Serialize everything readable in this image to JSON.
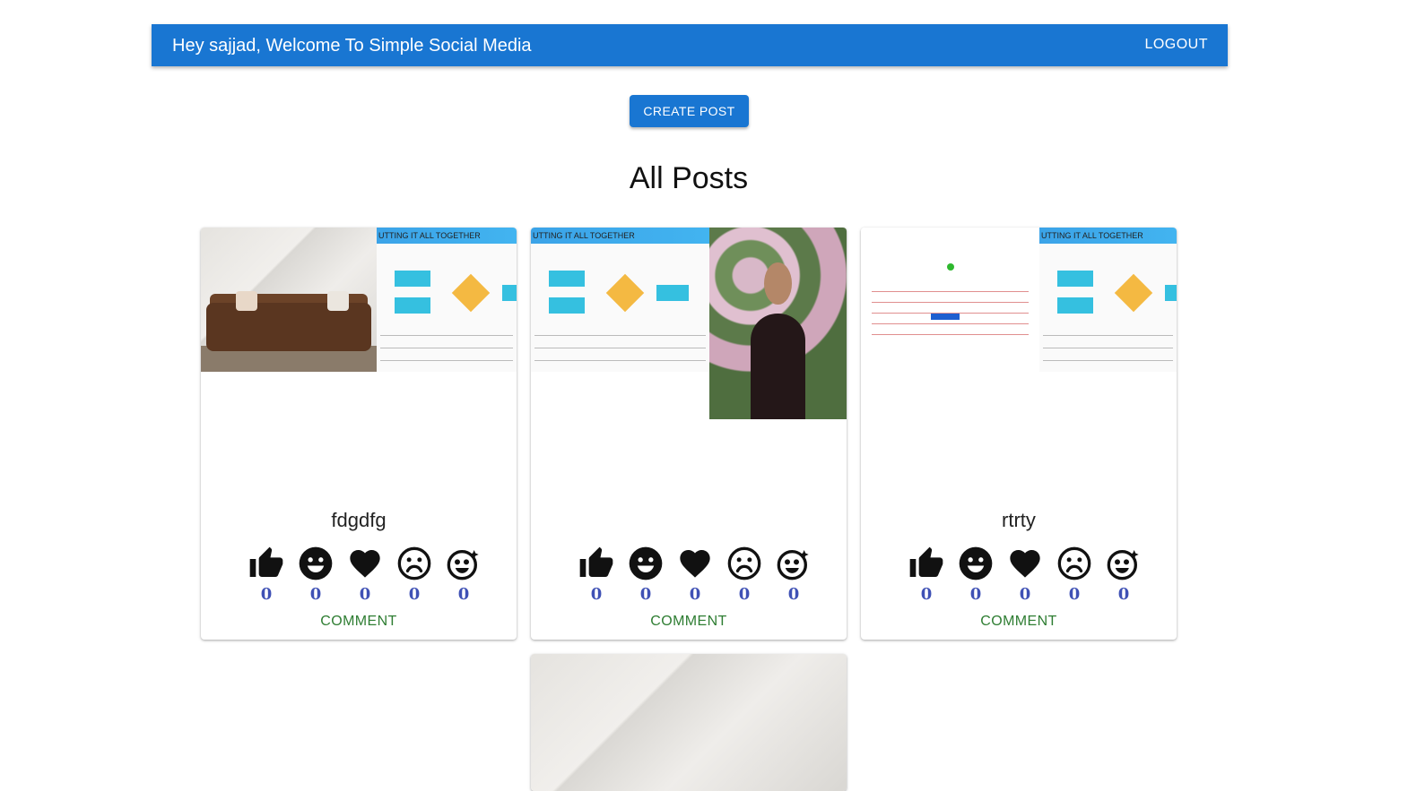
{
  "header": {
    "greeting": "Hey sajjad, Welcome To Simple Social Media",
    "logout_label": "LOGOUT"
  },
  "actions": {
    "create_post_label": "CREATE POST"
  },
  "page": {
    "title": "All Posts"
  },
  "posts": [
    {
      "title": "fdgdfg",
      "image_caption": "UTTING IT ALL TOGETHER",
      "reactions": {
        "like": "0",
        "happy": "0",
        "love": "0",
        "sad": "0",
        "amazed": "0"
      },
      "comment_label": "COMMENT"
    },
    {
      "title": "",
      "image_caption": "UTTING IT ALL TOGETHER",
      "reactions": {
        "like": "0",
        "happy": "0",
        "love": "0",
        "sad": "0",
        "amazed": "0"
      },
      "comment_label": "COMMENT"
    },
    {
      "title": "rtrty",
      "image_caption": "UTTING IT ALL TOGETHER",
      "reactions": {
        "like": "0",
        "happy": "0",
        "love": "0",
        "sad": "0",
        "amazed": "0"
      },
      "comment_label": "COMMENT"
    }
  ],
  "colors": {
    "primary": "#1976d2",
    "comment": "#2e7d32",
    "count": "#3f51b5"
  },
  "icons": [
    "thumb-up-icon",
    "happy-face-icon",
    "heart-icon",
    "sad-face-icon",
    "amazed-face-icon"
  ]
}
